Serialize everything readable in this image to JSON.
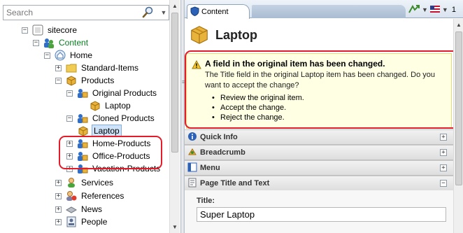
{
  "search": {
    "placeholder": "Search",
    "value": ""
  },
  "tree": {
    "nodes": [
      {
        "label": "sitecore",
        "expander": "−",
        "icon": "sitecore-icon"
      },
      {
        "label": "Content",
        "expander": "−",
        "icon": "content-icon"
      },
      {
        "label": "Home",
        "expander": "−",
        "icon": "home-icon"
      },
      {
        "label": "Standard-Items",
        "expander": "+",
        "icon": "folder-icon"
      },
      {
        "label": "Products",
        "expander": "−",
        "icon": "package-icon"
      },
      {
        "label": "Original Products",
        "expander": "−",
        "icon": "products-icon"
      },
      {
        "label": "Laptop",
        "expander": "",
        "icon": "package-icon"
      },
      {
        "label": "Cloned Products",
        "expander": "−",
        "icon": "products-icon"
      },
      {
        "label": "Laptop",
        "expander": "",
        "icon": "package-icon"
      },
      {
        "label": "Home-Products",
        "expander": "+",
        "icon": "products-icon"
      },
      {
        "label": "Office-Products",
        "expander": "+",
        "icon": "products-icon"
      },
      {
        "label": "Vacation-Products",
        "expander": "+",
        "icon": "products-icon"
      },
      {
        "label": "Services",
        "expander": "+",
        "icon": "person-icon"
      },
      {
        "label": "References",
        "expander": "+",
        "icon": "references-icon"
      },
      {
        "label": "News",
        "expander": "+",
        "icon": "news-icon"
      },
      {
        "label": "People",
        "expander": "+",
        "icon": "people-icon"
      }
    ]
  },
  "tabs": {
    "content_label": "Content",
    "language_code": "1"
  },
  "item": {
    "title": "Laptop"
  },
  "warning": {
    "title": "A field in the original item has been changed.",
    "message": "The Title field in the original Laptop item has been changed. Do you want to accept the change?",
    "actions": [
      "Review the original item.",
      "Accept the change.",
      "Reject the change."
    ]
  },
  "sections": [
    {
      "label": "Quick Info",
      "toggle": "+",
      "icon": "info-icon"
    },
    {
      "label": "Breadcrumb",
      "toggle": "+",
      "icon": "breadcrumb-icon"
    },
    {
      "label": "Menu",
      "toggle": "+",
      "icon": "menu-icon"
    },
    {
      "label": "Page Title and Text",
      "toggle": "−",
      "icon": "page-icon"
    }
  ],
  "field": {
    "label": "Title:",
    "value": "Super Laptop"
  },
  "colors": {
    "highlight": "#e51b2a",
    "warning_bg": "#ffffe3",
    "selected_bg": "#cfe3f8",
    "content_green": "#067e1f"
  }
}
